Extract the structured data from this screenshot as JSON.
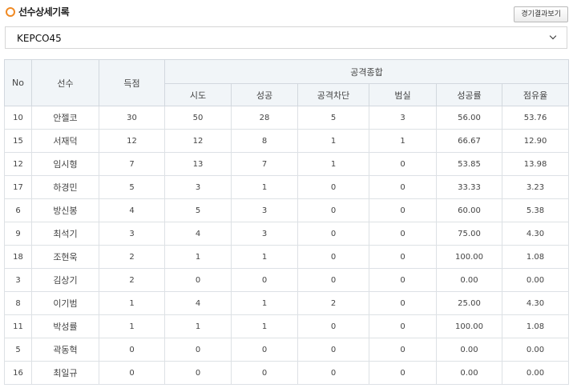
{
  "header": {
    "title": "선수상세기록",
    "result_button": "경기결과보기"
  },
  "team_select": {
    "selected": "KEPCO45"
  },
  "table": {
    "col_no": "No",
    "col_player": "선수",
    "col_points": "득점",
    "group_attack": "공격종합",
    "sub": [
      "시도",
      "성공",
      "공격차단",
      "범실",
      "성공률",
      "점유율"
    ],
    "rows": [
      [
        "10",
        "안젤코",
        "30",
        "50",
        "28",
        "5",
        "3",
        "56.00",
        "53.76"
      ],
      [
        "15",
        "서재덕",
        "12",
        "12",
        "8",
        "1",
        "1",
        "66.67",
        "12.90"
      ],
      [
        "12",
        "임시형",
        "7",
        "13",
        "7",
        "1",
        "0",
        "53.85",
        "13.98"
      ],
      [
        "17",
        "하경민",
        "5",
        "3",
        "1",
        "0",
        "0",
        "33.33",
        "3.23"
      ],
      [
        "6",
        "방신봉",
        "4",
        "5",
        "3",
        "0",
        "0",
        "60.00",
        "5.38"
      ],
      [
        "9",
        "최석기",
        "3",
        "4",
        "3",
        "0",
        "0",
        "75.00",
        "4.30"
      ],
      [
        "18",
        "조현욱",
        "2",
        "1",
        "1",
        "0",
        "0",
        "100.00",
        "1.08"
      ],
      [
        "3",
        "김상기",
        "2",
        "0",
        "0",
        "0",
        "0",
        "0.00",
        "0.00"
      ],
      [
        "8",
        "이기범",
        "1",
        "4",
        "1",
        "2",
        "0",
        "25.00",
        "4.30"
      ],
      [
        "11",
        "박성률",
        "1",
        "1",
        "1",
        "0",
        "0",
        "100.00",
        "1.08"
      ],
      [
        "5",
        "곽동혁",
        "0",
        "0",
        "0",
        "0",
        "0",
        "0.00",
        "0.00"
      ],
      [
        "16",
        "최일규",
        "0",
        "0",
        "0",
        "0",
        "0",
        "0.00",
        "0.00"
      ]
    ]
  }
}
